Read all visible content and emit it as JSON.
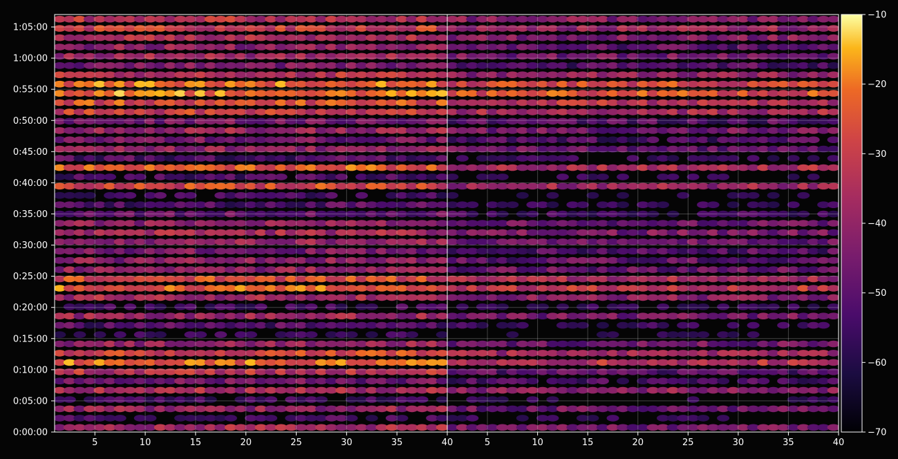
{
  "chart_data": {
    "type": "heatmap",
    "panels": [
      {
        "name": "",
        "x_range": [
          1,
          40
        ],
        "x_ticks": [
          "5",
          "10",
          "15",
          "20",
          "25",
          "30",
          "35",
          "40"
        ],
        "band_intensity": [
          0.55,
          0.25,
          0.5,
          0.22,
          0.55,
          0.38,
          0.6,
          0.8,
          0.7,
          0.5,
          0.18,
          0.3,
          0.52,
          0.22,
          0.55,
          0.78,
          0.7,
          0.48,
          0.46,
          0.42,
          0.5,
          0.55,
          0.48,
          0.35,
          0.3,
          0.22,
          0.7,
          0.28,
          0.75,
          0.3,
          0.48,
          0.4,
          0.52,
          0.4,
          0.66,
          0.72,
          0.82,
          0.8,
          0.6,
          0.42,
          0.52,
          0.48,
          0.58,
          0.65,
          0.6
        ]
      },
      {
        "name": "",
        "x_range": [
          1,
          40
        ],
        "x_ticks": [
          "5",
          "10",
          "15",
          "20",
          "25",
          "30",
          "35",
          "40"
        ],
        "band_intensity": [
          0.4,
          0.15,
          0.38,
          0.12,
          0.48,
          0.26,
          0.32,
          0.6,
          0.54,
          0.38,
          0.1,
          0.2,
          0.4,
          0.15,
          0.45,
          0.62,
          0.55,
          0.36,
          0.34,
          0.3,
          0.38,
          0.42,
          0.36,
          0.24,
          0.18,
          0.1,
          0.52,
          0.16,
          0.58,
          0.18,
          0.36,
          0.28,
          0.4,
          0.3,
          0.55,
          0.6,
          0.72,
          0.7,
          0.48,
          0.3,
          0.4,
          0.34,
          0.44,
          0.5,
          0.46
        ]
      }
    ],
    "y_range": [
      "0:00:00",
      "1:07:00"
    ],
    "y_ticks": [
      "0:00:00",
      "0:05:00",
      "0:10:00",
      "0:15:00",
      "0:20:00",
      "0:25:00",
      "0:30:00",
      "0:35:00",
      "0:40:00",
      "0:45:00",
      "0:50:00",
      "0:55:00",
      "1:00:00",
      "1:05:00"
    ],
    "colorbar": {
      "range": [
        -70,
        -10
      ],
      "ticks": [
        "−10",
        "−20",
        "−30",
        "−40",
        "−50",
        "−60",
        "−70"
      ],
      "colormap": "inferno"
    },
    "grid": true,
    "background": "#050505"
  }
}
